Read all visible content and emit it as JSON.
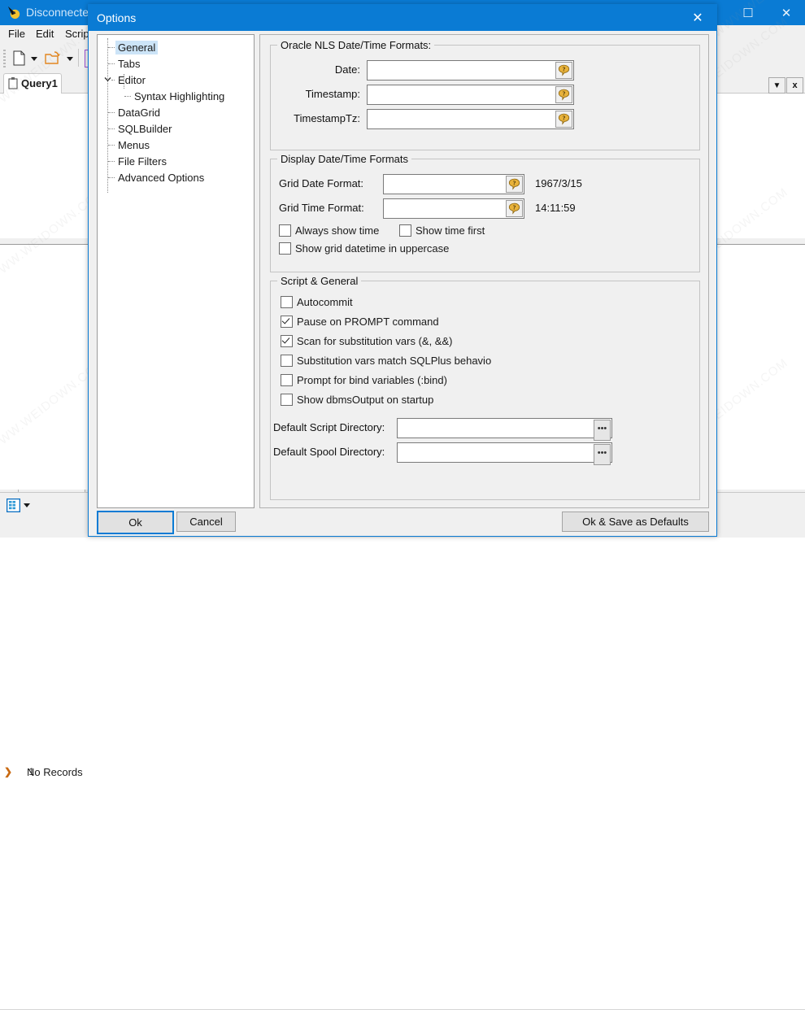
{
  "background_window": {
    "title": "Disconnected",
    "title_icon": "app-icon",
    "window_buttons": {
      "maximize": "☐",
      "close": "✕"
    },
    "menus": [
      "File",
      "Edit",
      "Scrip"
    ],
    "toolbar": {
      "new_icon": "new-document-icon",
      "open_icon": "open-folder-icon",
      "dropdown_glyph": "▼"
    },
    "tab": {
      "label": "Query1",
      "icon": "query-tab-icon"
    },
    "tab_buttons": {
      "dropdown": "▼",
      "close": "x"
    },
    "grid": {
      "row_number": "1",
      "cell_text": "No Records",
      "row_arrow": "❯"
    },
    "statusbar": {
      "grid_icon": "grid-view-icon"
    }
  },
  "watermark": {
    "text": "WWW.WEIDOWN.COM"
  },
  "dialog": {
    "title": "Options",
    "close_glyph": "✕",
    "tree": {
      "items": [
        {
          "label": "General",
          "selected": true,
          "indent": 0,
          "expander": ""
        },
        {
          "label": "Tabs",
          "selected": false,
          "indent": 0,
          "expander": ""
        },
        {
          "label": "Editor",
          "selected": false,
          "indent": 0,
          "expander": "chevron-down-icon"
        },
        {
          "label": "Syntax Highlighting",
          "selected": false,
          "indent": 1,
          "expander": ""
        },
        {
          "label": "DataGrid",
          "selected": false,
          "indent": 0,
          "expander": ""
        },
        {
          "label": "SQLBuilder",
          "selected": false,
          "indent": 0,
          "expander": ""
        },
        {
          "label": "Menus",
          "selected": false,
          "indent": 0,
          "expander": ""
        },
        {
          "label": "File Filters",
          "selected": false,
          "indent": 0,
          "expander": ""
        },
        {
          "label": "Advanced Options",
          "selected": false,
          "indent": 0,
          "expander": ""
        }
      ]
    },
    "nls_group": {
      "title": "Oracle NLS Date/Time Formats:",
      "fields": [
        {
          "label": "Date:",
          "value": "",
          "help_icon": "help-question-icon"
        },
        {
          "label": "Timestamp:",
          "value": "",
          "help_icon": "help-question-icon"
        },
        {
          "label": "TimestampTz:",
          "value": "",
          "help_icon": "help-question-icon"
        }
      ]
    },
    "display_group": {
      "title": "Display Date/Time Formats",
      "fields": [
        {
          "label": "Grid Date Format:",
          "value": "",
          "sample": "1967/3/15",
          "help_icon": "help-question-icon"
        },
        {
          "label": "Grid Time Format:",
          "value": "",
          "sample": "14:11:59",
          "help_icon": "help-question-icon"
        }
      ],
      "checkboxes": [
        {
          "label": "Always show time",
          "checked": false
        },
        {
          "label": "Show time first",
          "checked": false
        },
        {
          "label": "Show grid datetime in uppercase",
          "checked": false
        }
      ]
    },
    "script_group": {
      "title": "Script & General",
      "checkboxes": [
        {
          "label": "Autocommit",
          "checked": false
        },
        {
          "label": "Pause on PROMPT command",
          "checked": true
        },
        {
          "label": "Scan for substitution vars (&, &&)",
          "checked": true
        },
        {
          "label": "Substitution vars match SQLPlus behavio",
          "checked": false
        },
        {
          "label": "Prompt for bind variables (:bind)",
          "checked": false
        },
        {
          "label": "Show dbmsOutput on startup",
          "checked": false
        }
      ],
      "directories": [
        {
          "label": "Default Script Directory:",
          "value": "",
          "browse_glyph": "•••"
        },
        {
          "label": "Default Spool Directory:",
          "value": "",
          "browse_glyph": "•••"
        }
      ]
    },
    "buttons": {
      "ok": "Ok",
      "cancel": "Cancel",
      "ok_save_defaults": "Ok & Save as Defaults"
    }
  },
  "colors": {
    "titlebar_blue": "#0a7bd4",
    "selection_blue": "#cce4f7",
    "dialog_face": "#f0f0f0",
    "help_icon_gold": "#e8b23a"
  }
}
